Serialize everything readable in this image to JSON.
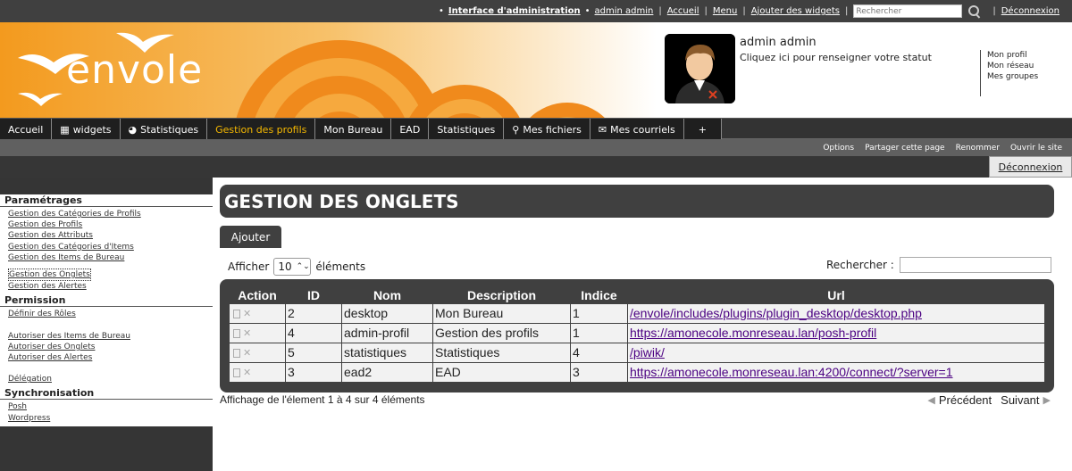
{
  "topbar": {
    "admin_interface": "Interface d'administration",
    "user": "admin admin",
    "home": "Accueil",
    "menu": "Menu",
    "add_widgets": "Ajouter des widgets",
    "search_placeholder": "Rechercher",
    "logout": "Déconnexion"
  },
  "banner": {
    "logo_text": "envole",
    "user_name": "admin admin",
    "status_prompt": "Cliquez ici pour renseigner votre statut",
    "profile_links": [
      "Mon profil",
      "Mon réseau",
      "Mes groupes"
    ],
    "colors": {
      "orange": "#f08a1c",
      "light_orange": "#f7b04a"
    }
  },
  "nav": {
    "tabs": [
      {
        "label": "Accueil",
        "icon": ""
      },
      {
        "label": "widgets",
        "icon": "widgets-icon"
      },
      {
        "label": "Statistiques",
        "icon": "pie-chart-icon"
      },
      {
        "label": "Gestion des profils",
        "icon": "",
        "active": true
      },
      {
        "label": "Mon Bureau",
        "icon": ""
      },
      {
        "label": "EAD",
        "icon": ""
      },
      {
        "label": "Statistiques",
        "icon": ""
      },
      {
        "label": "Mes fichiers",
        "icon": "paperclip-icon"
      },
      {
        "label": "Mes courriels",
        "icon": "envelope-icon"
      },
      {
        "label": "+",
        "icon": ""
      }
    ]
  },
  "subnav": [
    "Options",
    "Partager cette page",
    "Renommer",
    "Ouvrir le site"
  ],
  "logoutbar": {
    "label": "Déconnexion"
  },
  "sidebar": {
    "sections": [
      {
        "title": "Paramétrages",
        "links": [
          "Gestion des Catégories de Profils",
          "Gestion des Profils",
          "Gestion des Attributs",
          "Gestion des Catégories d'Items",
          "Gestion des Items de Bureau",
          "Gestion des Onglets",
          "Gestion des Alertes"
        ]
      },
      {
        "title": "Permission",
        "links": [
          "Définir des Rôles",
          "",
          "Autoriser des Items de Bureau",
          "Autoriser des Onglets",
          "Autoriser des Alertes",
          "",
          "Délégation"
        ]
      },
      {
        "title": "Synchronisation",
        "links": [
          "Posh",
          "Wordpress"
        ]
      }
    ]
  },
  "main": {
    "title": "GESTION DES ONGLETS",
    "add_button": "Ajouter",
    "show_label": "Afficher",
    "show_value": "10",
    "show_suffix": "éléments",
    "search_label": "Rechercher :",
    "columns": [
      "Action",
      "ID",
      "Nom",
      "Description",
      "Indice",
      "Url"
    ],
    "rows": [
      {
        "id": "2",
        "nom": "desktop",
        "description": "Mon Bureau",
        "indice": "1",
        "url": "/envole/includes/plugins/plugin_desktop/desktop.php"
      },
      {
        "id": "4",
        "nom": "admin-profil",
        "description": "Gestion des profils",
        "indice": "1",
        "url": "https://amonecole.monreseau.lan/posh-profil"
      },
      {
        "id": "5",
        "nom": "statistiques",
        "description": "Statistiques",
        "indice": "4",
        "url": "/piwik/"
      },
      {
        "id": "3",
        "nom": "ead2",
        "description": "EAD",
        "indice": "3",
        "url": "https://amonecole.monreseau.lan:4200/connect/?server=1"
      }
    ],
    "info": "Affichage de l'élement 1 à 4 sur 4 éléments",
    "prev": "Précédent",
    "next": "Suivant"
  }
}
